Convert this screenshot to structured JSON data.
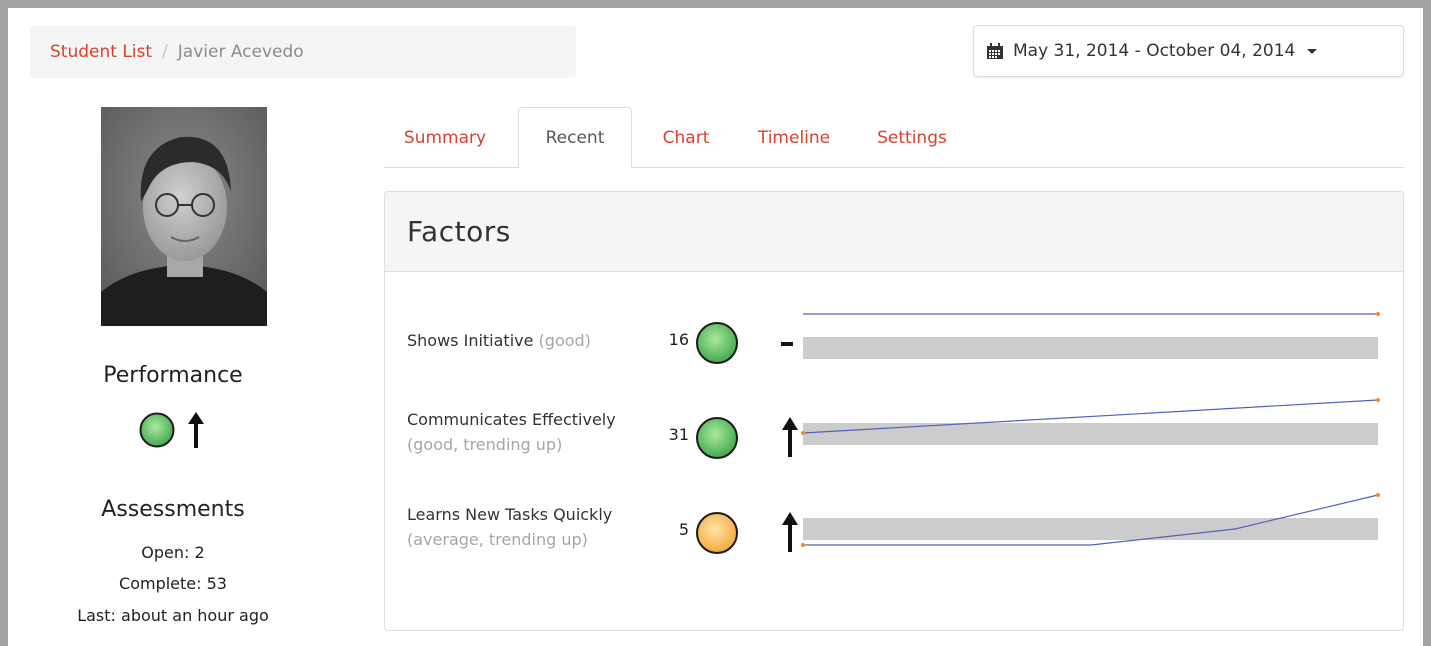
{
  "breadcrumb": {
    "parent": "Student List",
    "separator": "/",
    "current": "Javier Acevedo"
  },
  "date_range": {
    "label": "May 31, 2014 - October 04, 2014"
  },
  "student": {
    "photo_icon": "student-photo"
  },
  "performance": {
    "title": "Performance",
    "status": "good",
    "trend": "up"
  },
  "assessments": {
    "title": "Assessments",
    "open": "Open: 2",
    "complete": "Complete: 53",
    "last": "Last: about an hour ago"
  },
  "tabs": [
    {
      "label": "Summary",
      "active": false
    },
    {
      "label": "Recent",
      "active": true
    },
    {
      "label": "Chart",
      "active": false
    },
    {
      "label": "Timeline",
      "active": false
    },
    {
      "label": "Settings",
      "active": false
    }
  ],
  "panel": {
    "title": "Factors"
  },
  "factors": [
    {
      "name": "Shows Initiative",
      "qualifier": "(good)",
      "count": "16",
      "status": "good",
      "trend": "flat",
      "sparkline": [
        1,
        1
      ]
    },
    {
      "name": "Communicates Effectively",
      "qualifier": "(good, trending up)",
      "count": "31",
      "status": "good",
      "trend": "up",
      "sparkline": [
        0.78,
        1
      ]
    },
    {
      "name": "Learns New Tasks Quickly",
      "qualifier": "(average, trending up)",
      "count": "5",
      "status": "average",
      "trend": "up",
      "sparkline": [
        0.8,
        0.8,
        0.88,
        1.08
      ]
    }
  ],
  "colors": {
    "link": "#d9412f",
    "good_light": "#9ee39a",
    "good_dark": "#3fa34a",
    "average_light": "#ffe0a0",
    "average_dark": "#f2a33a",
    "spark_line": "#5361b8",
    "spark_dot": "#f28a2a",
    "spark_band": "#cccccc"
  }
}
